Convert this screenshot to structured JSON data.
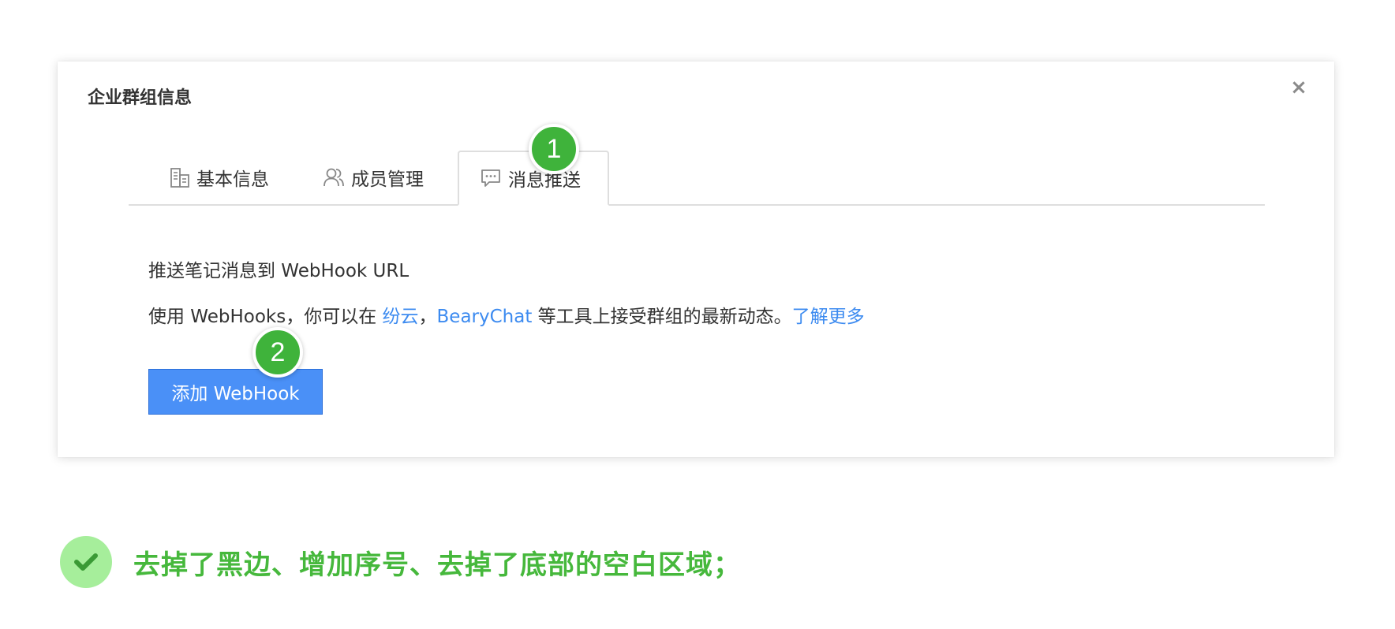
{
  "dialog": {
    "title": "企业群组信息",
    "close_symbol": "×",
    "tabs": [
      {
        "label": "基本信息",
        "icon": "building-icon"
      },
      {
        "label": "成员管理",
        "icon": "users-icon"
      },
      {
        "label": "消息推送",
        "icon": "message-icon"
      }
    ],
    "heading": "推送笔记消息到 WebHook URL",
    "description": {
      "prefix": "使用 WebHooks，你可以在 ",
      "link1": "纷云",
      "sep": "，",
      "link2": "BearyChat",
      "middle": " 等工具上接受群组的最新动态。",
      "link3": "了解更多"
    },
    "add_button": "添加 WebHook"
  },
  "badges": [
    "1",
    "2"
  ],
  "note": {
    "text": "去掉了黑边、增加序号、去掉了底部的空白区域；"
  },
  "colors": {
    "primary_button": "#4a90f7",
    "link": "#3d8bf0",
    "badge": "#3fb33b",
    "note_text": "#46b83c",
    "check_circle": "#a6ee9b"
  }
}
